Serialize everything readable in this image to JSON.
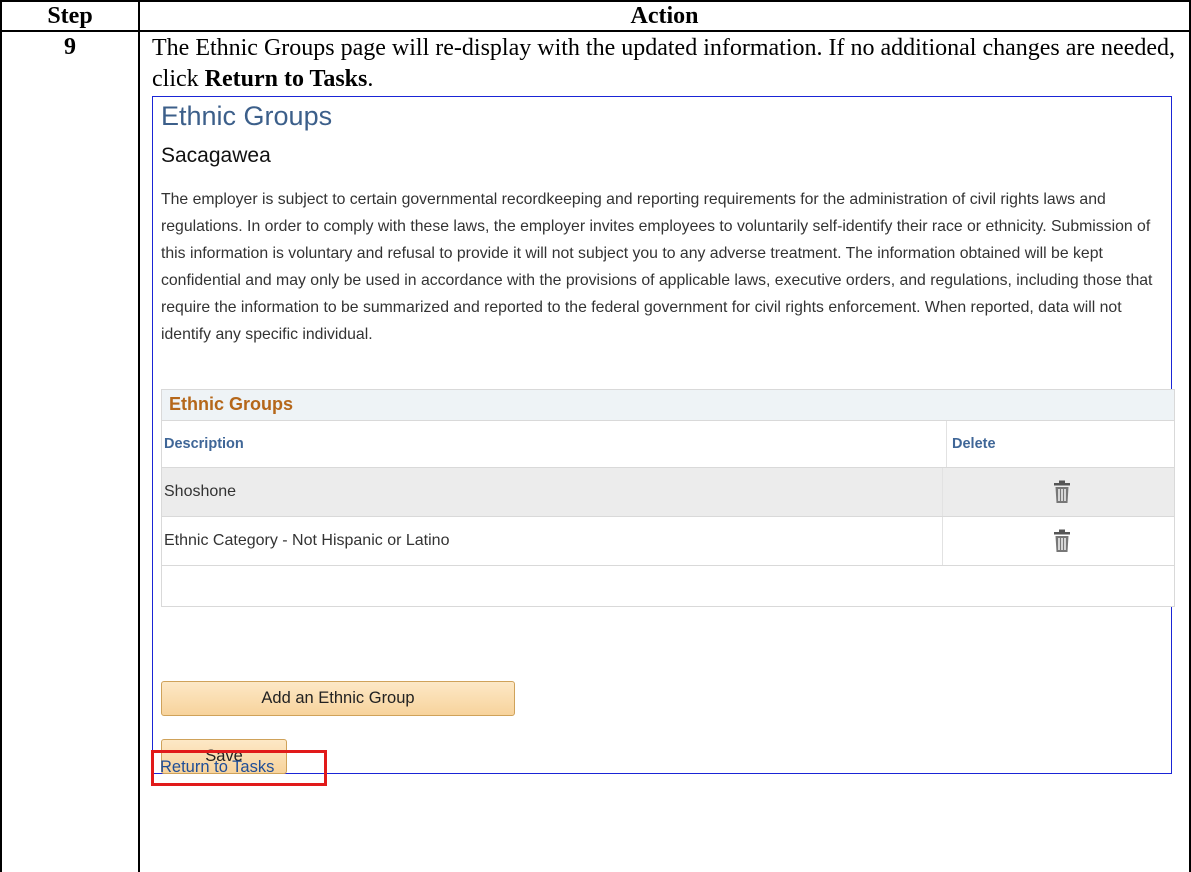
{
  "table": {
    "header_step": "Step",
    "header_action": "Action",
    "step_number": "9",
    "instruction_part1": "The Ethnic Groups page will re-display with the updated information.  If no additional changes are needed, click ",
    "instruction_bold": "Return to Tasks",
    "instruction_end": "."
  },
  "screen": {
    "title": "Ethnic Groups",
    "person_name": "Sacagawea",
    "paragraph": "The employer is subject to certain governmental recordkeeping and reporting requirements for the administration of civil rights laws and regulations. In order to comply with these laws, the employer invites employees to voluntarily self-identify their race or ethnicity. Submission of this information is voluntary and refusal to provide it will not subject you to any adverse treatment. The information obtained will be kept confidential and may only be used in accordance with the provisions of applicable laws, executive orders, and regulations, including those that require the information to be summarized and reported to the federal government for civil rights enforcement. When reported, data will not identify any specific individual.",
    "grid": {
      "title": "Ethnic Groups",
      "columns": [
        "Description",
        "Delete"
      ],
      "rows": [
        {
          "description": "Shoshone",
          "delete_icon": "trash-icon"
        },
        {
          "description": "Ethnic Category - Not Hispanic or Latino",
          "delete_icon": "trash-icon"
        }
      ]
    },
    "add_button": "Add an Ethnic Group",
    "save_button": "Save",
    "return_link": "Return to Tasks",
    "highlight_color": "#e11a1a",
    "title_color": "#3c5f8a",
    "grid_title_color": "#b5671a"
  }
}
